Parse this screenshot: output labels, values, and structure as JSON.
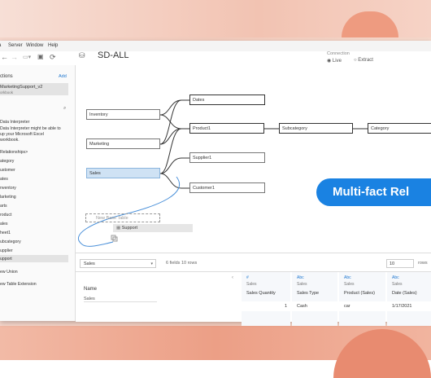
{
  "menu": [
    "a",
    "Server",
    "Window",
    "Help"
  ],
  "datasource": {
    "title": "SD-ALL"
  },
  "connection": {
    "label": "Connection",
    "live": "Live",
    "extract": "Extract"
  },
  "sidebar": {
    "connections": "ctions",
    "add": "Add",
    "source_name": "MarketingSupport_v2",
    "source_sub": "orkbook",
    "interpreter_title": "Data Interpreter",
    "interpreter_text": [
      "Data Interpreter might be able to",
      "up your Microsoft Excel",
      "workbook."
    ],
    "relationships": "Relationships>",
    "items": [
      "ategory",
      "ustomer",
      "ates",
      "nventory",
      "larketing",
      "arts",
      "roduct",
      "ales",
      "heet1",
      "ubcategory",
      "upplier",
      "upport"
    ],
    "union": "ew Union",
    "extension": "ew Table Extension"
  },
  "tables": {
    "dates": "Dates",
    "inventory": "Inventory",
    "product1": "Product1",
    "subcategory": "Subcategory",
    "category": "Category",
    "marketing": "Marketing",
    "supplier1": "Supplier1",
    "sales": "Sales",
    "customer1": "Customer1",
    "new_base": "New Base Table",
    "support": "Support"
  },
  "banner": "Multi-fact Rel",
  "preview": {
    "table_select": "Sales",
    "info": "6 fields 10 rows",
    "rows_value": "10",
    "rows_label": "rows",
    "name_header": "Name",
    "name_value": "Sales",
    "columns": [
      {
        "type": "#",
        "source": "Sales",
        "name": "Sales Quantity",
        "value": "1"
      },
      {
        "type": "Abc",
        "source": "Sales",
        "name": "Sales Type",
        "value": "Cash"
      },
      {
        "type": "Abc",
        "source": "Sales",
        "name": "Product (Sales)",
        "value": "car"
      },
      {
        "type": "Abc",
        "source": "Sales",
        "name": "Date (Sales)",
        "value": "1/17/2021"
      }
    ]
  }
}
